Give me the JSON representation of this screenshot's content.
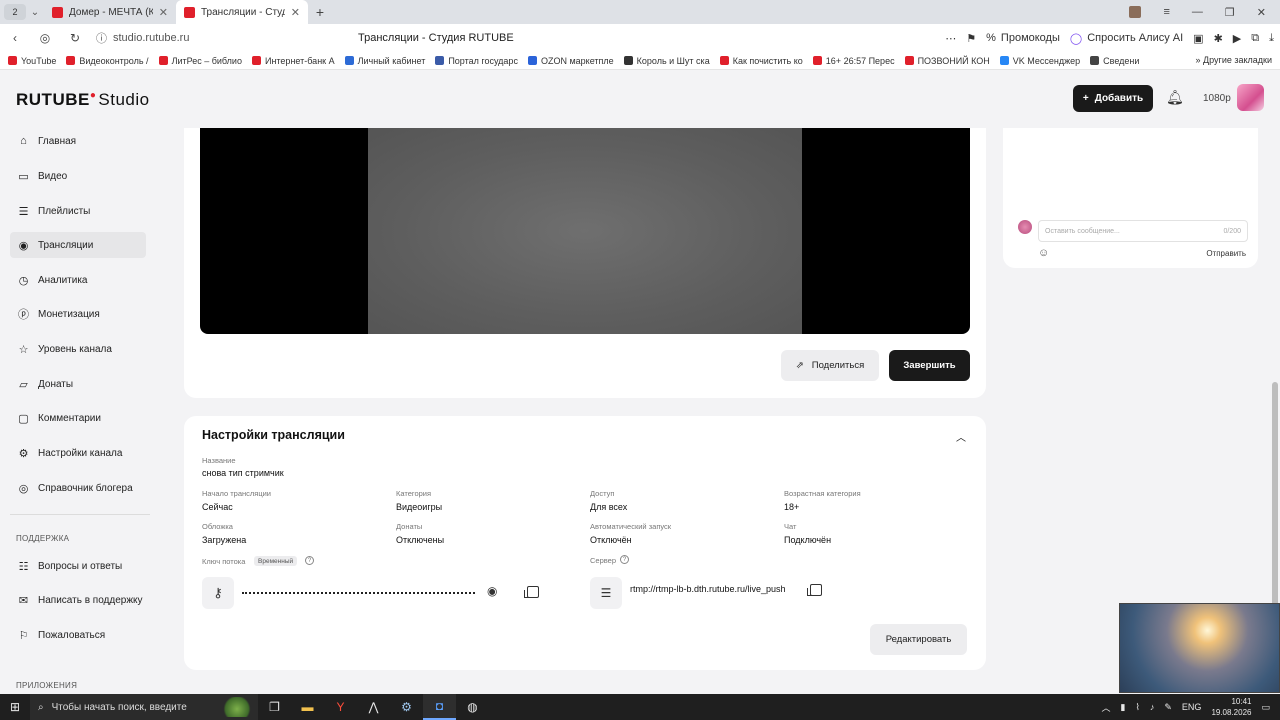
{
  "browser": {
    "tab_counter": "2",
    "tabs": [
      {
        "title": "Домер - МЕЧТА (Кл"
      },
      {
        "title": "Трансляции - Студия R"
      }
    ],
    "url": "studio.rutube.ru",
    "page_title": "Трансляции - Студия RUTUBE",
    "toolbar": {
      "promo": "Промокоды",
      "alice": "Спросить Алису AI"
    },
    "bookmarks": [
      "YouTube",
      "Видеоконтроль /",
      "ЛитРес – библио",
      "Интернет-банк А",
      "Личный кабинет",
      "Портал государс",
      "OZON маркетпле",
      "Король и Шут ска",
      "Как почистить ко",
      "16+ 26:57 Перес",
      "ПОЗВОНИЙ КОН",
      "VK Мессенджер",
      "Сведени"
    ],
    "bookmarks_other": "Другие закладки"
  },
  "header": {
    "logo_main": "RUTUBE",
    "logo_studio": "Studio",
    "add_button": "Добавить",
    "quality": "1080p"
  },
  "sidebar": {
    "items": [
      {
        "label": "Главная",
        "icon": "home-icon"
      },
      {
        "label": "Видео",
        "icon": "video-icon"
      },
      {
        "label": "Плейлисты",
        "icon": "playlist-icon"
      },
      {
        "label": "Трансляции",
        "icon": "broadcast-icon"
      },
      {
        "label": "Аналитика",
        "icon": "analytics-icon"
      },
      {
        "label": "Монетизация",
        "icon": "monetization-icon"
      },
      {
        "label": "Уровень канала",
        "icon": "star-icon"
      },
      {
        "label": "Донаты",
        "icon": "donate-icon"
      },
      {
        "label": "Комментарии",
        "icon": "comments-icon"
      },
      {
        "label": "Настройки канала",
        "icon": "settings-icon"
      },
      {
        "label": "Справочник блогера",
        "icon": "help-book-icon"
      }
    ],
    "support_title": "ПОДДЕРЖКА",
    "support_items": [
      {
        "label": "Вопросы и ответы",
        "icon": "faq-icon"
      },
      {
        "label": "Написать в поддержку",
        "icon": "mail-icon"
      },
      {
        "label": "Пожаловаться",
        "icon": "flag-icon"
      }
    ],
    "apps_title": "ПРИЛОЖЕНИЯ"
  },
  "stream": {
    "share_label": "Поделиться",
    "finish_label": "Завершить"
  },
  "settings": {
    "title": "Настройки трансляции",
    "name_label": "Название",
    "name_value": "снова тип стримчик",
    "start_label": "Начало трансляции",
    "start_value": "Сейчас",
    "category_label": "Категория",
    "category_value": "Видеоигры",
    "access_label": "Доступ",
    "access_value": "Для всех",
    "age_label": "Возрастная категория",
    "age_value": "18+",
    "cover_label": "Обложка",
    "cover_value": "Загружена",
    "donates_label": "Донаты",
    "donates_value": "Отключены",
    "autostart_label": "Автоматический запуск",
    "autostart_value": "Отключён",
    "chat_label": "Чат",
    "chat_value": "Подключён",
    "key_label": "Ключ потока",
    "key_badge": "Временный",
    "server_label": "Сервер",
    "server_value": "rtmp://rtmp-lb-b.dth.rutube.ru/live_push",
    "edit_label": "Редактировать"
  },
  "chat": {
    "placeholder": "Оставить сообщение...",
    "counter": "0/200",
    "send_label": "Отправить"
  },
  "taskbar": {
    "search_placeholder": "Чтобы начать поиск, введите",
    "lang": "ENG",
    "time": "10:41",
    "date": "19.08.2026"
  }
}
